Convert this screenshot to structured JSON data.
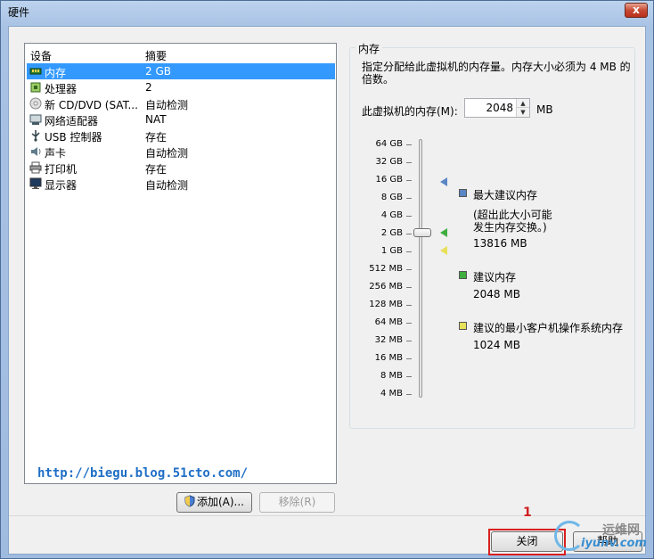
{
  "window": {
    "title": "硬件",
    "close_glyph": "x"
  },
  "device_list": {
    "headers": {
      "device": "设备",
      "summary": "摘要"
    },
    "rows": [
      {
        "device": "内存",
        "summary": "2 GB",
        "icon": "memory-icon"
      },
      {
        "device": "处理器",
        "summary": "2",
        "icon": "processor-icon"
      },
      {
        "device": "新 CD/DVD (SAT...",
        "summary": "自动检测",
        "icon": "cd-dvd-icon"
      },
      {
        "device": "网络适配器",
        "summary": "NAT",
        "icon": "network-adapter-icon"
      },
      {
        "device": "USB 控制器",
        "summary": "存在",
        "icon": "usb-icon"
      },
      {
        "device": "声卡",
        "summary": "自动检测",
        "icon": "sound-icon"
      },
      {
        "device": "打印机",
        "summary": "存在",
        "icon": "printer-icon"
      },
      {
        "device": "显示器",
        "summary": "自动检测",
        "icon": "display-icon"
      }
    ],
    "selected_index": 0
  },
  "watermark_url": "http://biegu.blog.51cto.com/",
  "buttons": {
    "add": "添加(A)...",
    "remove": "移除(R)",
    "close": "关闭",
    "help": "帮助"
  },
  "memory_panel": {
    "group_title": "内存",
    "description": "指定分配给此虚拟机的内存量。内存大小必须为 4 MB 的倍数。",
    "memory_label": "此虚拟机的内存(M):",
    "memory_value": "2048",
    "unit": "MB",
    "scale": [
      "64 GB",
      "32 GB",
      "16 GB",
      "8 GB",
      "4 GB",
      "2 GB",
      "1 GB",
      "512 MB",
      "256 MB",
      "128 MB",
      "64 MB",
      "32 MB",
      "16 MB",
      "8 MB",
      "4 MB"
    ],
    "legend": {
      "max": {
        "title": "最大建议内存",
        "note_line1": "(超出此大小可能",
        "note_line2": "发生内存交换。)",
        "value": "13816 MB",
        "color": "#5a86c5"
      },
      "recommended": {
        "title": "建议内存",
        "value": "2048 MB",
        "color": "#3fae3f"
      },
      "guest_min": {
        "title": "建议的最小客户机操作系统内存",
        "value": "1024 MB",
        "color": "#e8e05a"
      }
    }
  },
  "annotation_number": "1",
  "site_watermark": {
    "line1": "运维网",
    "line2": "iyunv.com"
  }
}
